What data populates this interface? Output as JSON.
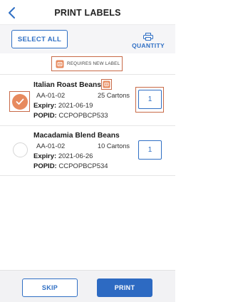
{
  "header": {
    "title": "PRINT LABELS",
    "back_icon": "chevron-left-icon"
  },
  "toolbar": {
    "select_all_label": "SELECT ALL",
    "quantity_label": "QUANTITY",
    "quantity_icon": "printer-icon"
  },
  "legend": {
    "text": "REQUIRES NEW LABEL",
    "icon": "new-label-icon"
  },
  "items": [
    {
      "selected": true,
      "name": "Italian Roast Beans",
      "requires_new_label": true,
      "location": "AA-01-02",
      "cartons": "25 Cartons",
      "expiry_label": "Expiry:",
      "expiry": "2021-06-19",
      "popid_label": "POPID:",
      "popid": "CCPOPBCP533",
      "quantity": "1"
    },
    {
      "selected": false,
      "name": "Macadamia Blend Beans",
      "requires_new_label": false,
      "location": "AA-01-02",
      "cartons": "10 Cartons",
      "expiry_label": "Expiry:",
      "expiry": "2021-06-26",
      "popid_label": "POPID:",
      "popid": "CCPOPBCP534",
      "quantity": "1"
    }
  ],
  "footer": {
    "skip_label": "SKIP",
    "print_label": "PRINT"
  },
  "colors": {
    "accent": "#2f6fc4",
    "primary_button": "#2d6ac2",
    "highlight": "#c86a48",
    "check": "#e78a5e"
  }
}
